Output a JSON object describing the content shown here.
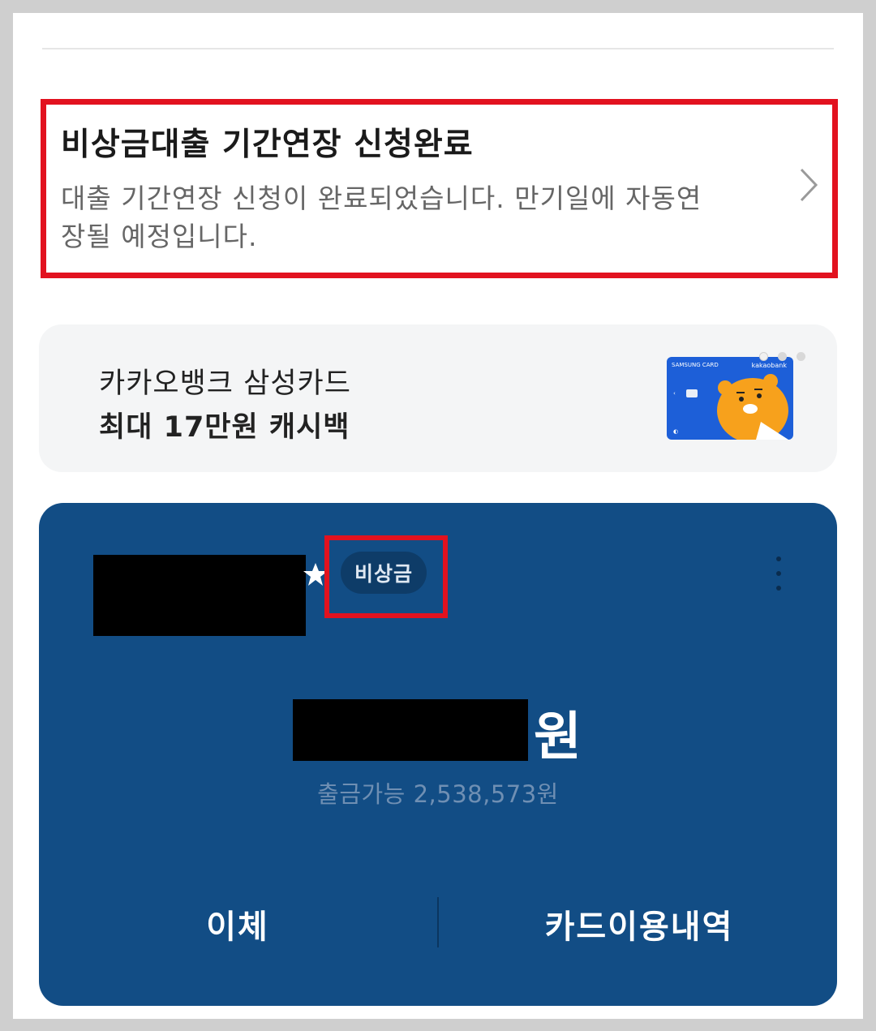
{
  "notice": {
    "title": "비상금대출 기간연장 신청완료",
    "body": "대출 기간연장 신청이 완료되었습니다. 만기일에 자동연장될 예정입니다."
  },
  "promo": {
    "line1": "카카오뱅크 삼성카드",
    "line2": "최대 17만원 캐시백",
    "card_brand_left": "SAMSUNG CARD",
    "card_brand_right": "kakaobank",
    "page_count": 3,
    "page_active_index": 1
  },
  "account": {
    "badge": "비상금",
    "balance_unit": "원",
    "withdrawable": "출금가능 2,538,573원",
    "actions": {
      "transfer": "이체",
      "card_history": "카드이용내역"
    }
  },
  "colors": {
    "highlight": "#e2121f",
    "account_bg": "#124d85",
    "card_blue": "#1d5fd8",
    "character_orange": "#f7a11c"
  }
}
